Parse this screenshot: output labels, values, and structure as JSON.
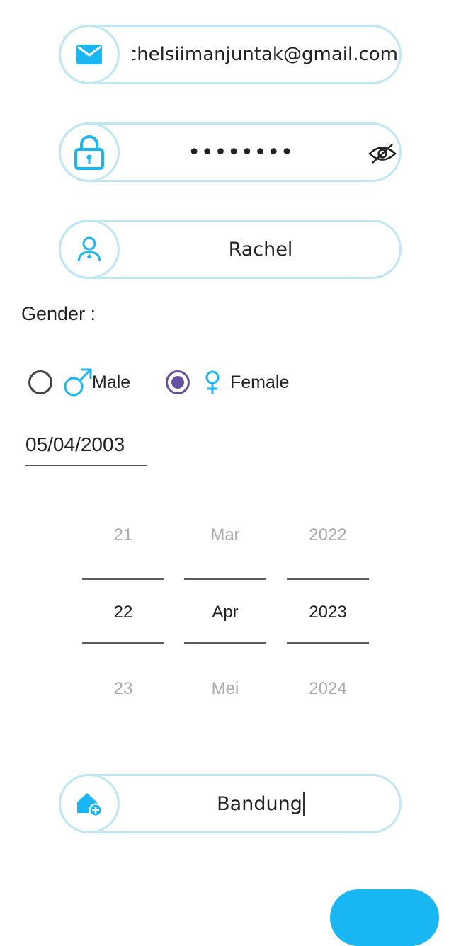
{
  "form": {
    "email": {
      "value": "rachelsiimanjuntak@gmail.com"
    },
    "password": {
      "masked_value": "••••••••"
    },
    "name": {
      "value": "Rachel"
    },
    "gender": {
      "label": "Gender  :",
      "options": [
        {
          "label": "Male",
          "symbol": "♂",
          "selected": false
        },
        {
          "label": "Female",
          "symbol": "♀",
          "selected": true
        }
      ]
    },
    "birth_date": {
      "value": "05/04/2003"
    },
    "date_picker": {
      "day": {
        "prev": "21",
        "selected": "22",
        "next": "23"
      },
      "month": {
        "prev": "Mar",
        "selected": "Apr",
        "next": "Mei"
      },
      "year": {
        "prev": "2022",
        "selected": "2023",
        "next": "2024"
      }
    },
    "city": {
      "value": "Bandung"
    }
  },
  "colors": {
    "accent": "#18b6f2",
    "field_border": "#bfe6f5",
    "radio_selected": "#6750a4"
  },
  "icons": [
    "mail-icon",
    "lock-icon",
    "eye-off-icon",
    "person-icon",
    "male-symbol-icon",
    "female-symbol-icon",
    "home-add-icon"
  ]
}
